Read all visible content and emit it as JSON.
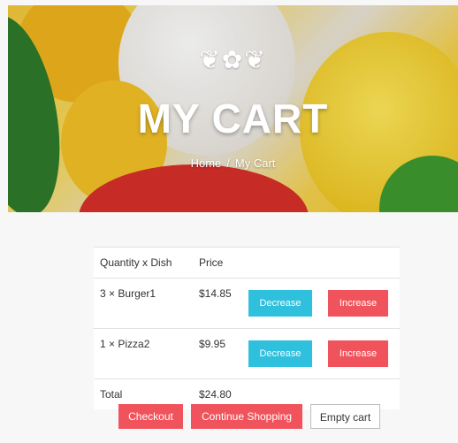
{
  "hero": {
    "ornament": "❦✿❦",
    "title": "MY CART",
    "breadcrumb": {
      "home": "Home",
      "separator": "/",
      "current": "My Cart"
    }
  },
  "cart": {
    "headers": {
      "dish": "Quantity x Dish",
      "price": "Price"
    },
    "items": [
      {
        "qty": "3",
        "times": "×",
        "dish": "Burger1",
        "price": "$14.85",
        "decrease": "Decrease",
        "increase": "Increase"
      },
      {
        "qty": "1",
        "times": "×",
        "dish": "Pizza2",
        "price": "$9.95",
        "decrease": "Decrease",
        "increase": "Increase"
      }
    ],
    "total_label": "Total",
    "total_value": "$24.80"
  },
  "actions": {
    "checkout": "Checkout",
    "continue": "Continue Shopping",
    "empty": "Empty cart"
  },
  "colors": {
    "danger": "#f0535b",
    "info": "#2ec0dc"
  }
}
